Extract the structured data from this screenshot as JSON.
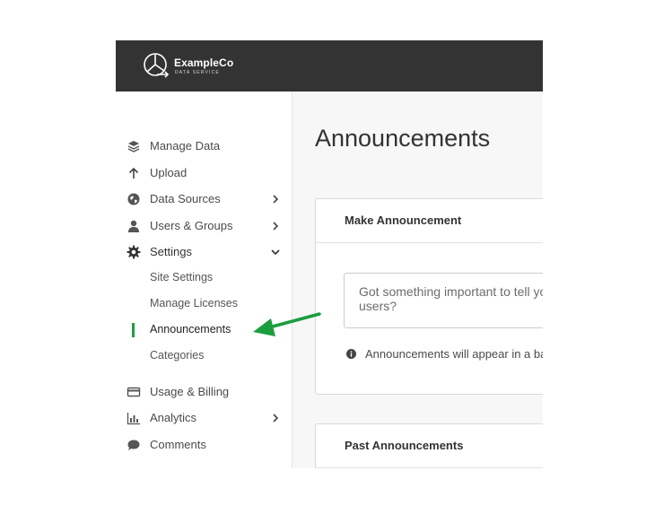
{
  "brand": {
    "name": "ExampleCo",
    "subtitle": "DATA SERVICE"
  },
  "sidebar": {
    "items": [
      {
        "label": "Manage Data",
        "icon": "layers-icon"
      },
      {
        "label": "Upload",
        "icon": "arrow-up-icon"
      },
      {
        "label": "Data Sources",
        "icon": "globe-icon",
        "chevron": "chevron-right-icon"
      },
      {
        "label": "Users & Groups",
        "icon": "user-icon",
        "chevron": "chevron-right-icon"
      },
      {
        "label": "Settings",
        "icon": "gear-icon",
        "chevron": "chevron-down-icon"
      },
      {
        "label": "Usage & Billing",
        "icon": "credit-card-icon"
      },
      {
        "label": "Analytics",
        "icon": "bar-chart-icon",
        "chevron": "chevron-right-icon"
      },
      {
        "label": "Comments",
        "icon": "comment-icon"
      }
    ],
    "settings_subitems": [
      {
        "label": "Site Settings"
      },
      {
        "label": "Manage Licenses"
      },
      {
        "label": "Announcements",
        "active": true
      },
      {
        "label": "Categories"
      }
    ]
  },
  "main": {
    "title": "Announcements",
    "make_card": {
      "title": "Make Announcement",
      "input_placeholder": "Got something important to tell your users?",
      "input_value": "",
      "info_text": "Announcements will appear in a banner at the top of the page."
    },
    "past_card": {
      "title": "Past Announcements"
    }
  },
  "colors": {
    "topbar": "#333333",
    "accent": "#1b9e3e",
    "annotation_arrow": "#1b9e3e"
  }
}
